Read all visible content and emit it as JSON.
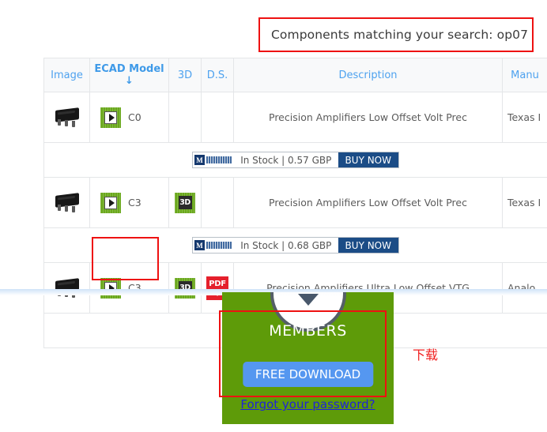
{
  "search_banner": {
    "text": "Components matching your search: op07"
  },
  "results_table": {
    "headers": [
      {
        "label": "Image",
        "name": "col-image"
      },
      {
        "label": "ECAD Model ↓",
        "name": "col-ecad"
      },
      {
        "label": "3D",
        "name": "col-3d"
      },
      {
        "label": "D.S.",
        "name": "col-ds"
      },
      {
        "label": "Description",
        "name": "col-description"
      },
      {
        "label": "Manu",
        "name": "col-manufacturer"
      }
    ],
    "rows": [
      {
        "ecad_label": "C0",
        "has_3d": false,
        "has_pdf": false,
        "description": "Precision Amplifiers Low Offset Volt Prec",
        "manufacturer": "Texas I",
        "buy": {
          "vendor": "M",
          "stock_text": "In Stock | 0.57 GBP",
          "button_label": "BUY NOW"
        }
      },
      {
        "ecad_label": "C3",
        "has_3d": true,
        "has_pdf": false,
        "description": "Precision Amplifiers Low Offset Volt Prec",
        "manufacturer": "Texas I",
        "buy": {
          "vendor": "M",
          "stock_text": "In Stock | 0.68 GBP",
          "button_label": "BUY NOW"
        }
      },
      {
        "ecad_label": "C3",
        "has_3d": true,
        "has_pdf": true,
        "description": "Precision Amplifiers Ultra Low Offset VTG",
        "manufacturer": "Analo",
        "buy": null
      }
    ]
  },
  "members_panel": {
    "title": "MEMBERS",
    "download_button": "FREE DOWNLOAD",
    "forgot_link": "Forgot your password?"
  },
  "annotation": {
    "cn_download": "下载"
  },
  "icons": {
    "ecad_play": "play-icon",
    "three_d": "3D",
    "pdf_label": "PDF",
    "chevron": "chevron-down-icon"
  },
  "colors": {
    "highlight": "#ee1111",
    "header_text": "#4ea2ef",
    "members_bg": "#5e9b09",
    "download_btn": "#5597f0",
    "buy_btn": "#1b4c86",
    "pdf": "#e5202c",
    "ecad_green": "#6aa81c",
    "annotation_red": "#f02020"
  }
}
